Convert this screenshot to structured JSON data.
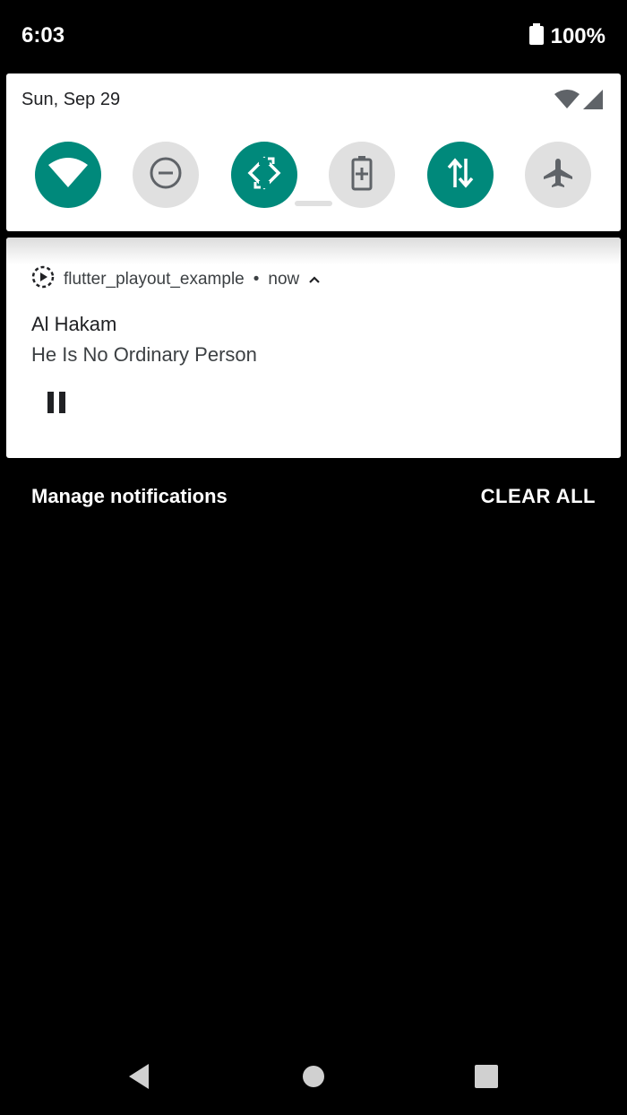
{
  "status_bar": {
    "time": "6:03",
    "battery": "100%"
  },
  "quick_settings": {
    "date": "Sun, Sep 29",
    "tiles": [
      {
        "name": "wifi",
        "state": "on"
      },
      {
        "name": "do-not-disturb",
        "state": "off"
      },
      {
        "name": "auto-rotate",
        "state": "on"
      },
      {
        "name": "battery-saver",
        "state": "off"
      },
      {
        "name": "mobile-data",
        "state": "on"
      },
      {
        "name": "airplane-mode",
        "state": "off"
      }
    ]
  },
  "notification": {
    "app_name": "flutter_playout_example",
    "separator": "•",
    "time": "now",
    "title": "Al Hakam",
    "text": "He Is No Ordinary Person",
    "action_icon": "pause-icon"
  },
  "footer": {
    "manage": "Manage notifications",
    "clear_all": "CLEAR ALL"
  },
  "colors": {
    "accent": "#00897b",
    "tile_off": "#e0e0e0",
    "panel": "#ffffff",
    "background": "#000000"
  }
}
